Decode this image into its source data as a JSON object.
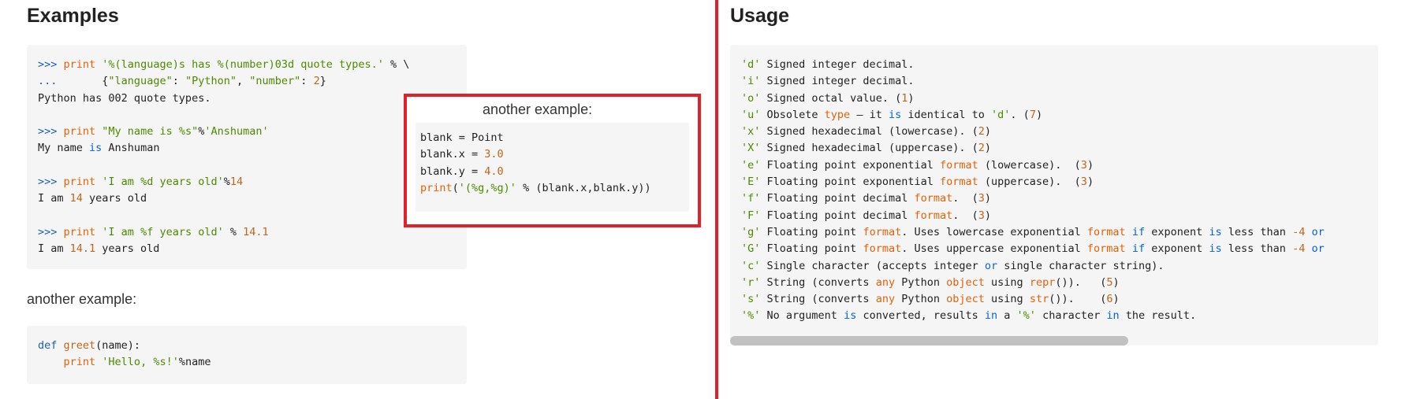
{
  "left": {
    "heading": "Examples",
    "code_block_1": [
      [
        {
          "t": ">>> ",
          "c": "pr"
        },
        {
          "t": "print ",
          "c": "kw"
        },
        {
          "t": "'%(language)s has %(number)03d quote types.'",
          "c": "str"
        },
        {
          "t": " % \\",
          "c": "plain"
        }
      ],
      [
        {
          "t": "...       ",
          "c": "pr"
        },
        {
          "t": "{",
          "c": "plain"
        },
        {
          "t": "\"language\"",
          "c": "str"
        },
        {
          "t": ": ",
          "c": "plain"
        },
        {
          "t": "\"Python\"",
          "c": "str"
        },
        {
          "t": ", ",
          "c": "plain"
        },
        {
          "t": "\"number\"",
          "c": "str"
        },
        {
          "t": ": ",
          "c": "plain"
        },
        {
          "t": "2",
          "c": "num"
        },
        {
          "t": "}",
          "c": "plain"
        }
      ],
      [
        {
          "t": "Python has 002 quote types.",
          "c": "plain"
        }
      ],
      [],
      [
        {
          "t": ">>> ",
          "c": "pr"
        },
        {
          "t": "print ",
          "c": "kw"
        },
        {
          "t": "\"My name is %s\"",
          "c": "str"
        },
        {
          "t": "%",
          "c": "plain"
        },
        {
          "t": "'Anshuman'",
          "c": "str"
        }
      ],
      [
        {
          "t": "My name ",
          "c": "plain"
        },
        {
          "t": "is",
          "c": "op"
        },
        {
          "t": " Anshuman",
          "c": "plain"
        }
      ],
      [],
      [
        {
          "t": ">>> ",
          "c": "pr"
        },
        {
          "t": "print ",
          "c": "kw"
        },
        {
          "t": "'I am %d years old'",
          "c": "str"
        },
        {
          "t": "%",
          "c": "plain"
        },
        {
          "t": "14",
          "c": "num"
        }
      ],
      [
        {
          "t": "I am ",
          "c": "plain"
        },
        {
          "t": "14",
          "c": "num"
        },
        {
          "t": " years old",
          "c": "plain"
        }
      ],
      [],
      [
        {
          "t": ">>> ",
          "c": "pr"
        },
        {
          "t": "print ",
          "c": "kw"
        },
        {
          "t": "'I am %f years old'",
          "c": "str"
        },
        {
          "t": " % ",
          "c": "plain"
        },
        {
          "t": "14.1",
          "c": "num"
        }
      ],
      [
        {
          "t": "I am ",
          "c": "plain"
        },
        {
          "t": "14.1",
          "c": "num"
        },
        {
          "t": " years old",
          "c": "plain"
        }
      ]
    ],
    "another_example_label": "another example:",
    "code_block_2": [
      [
        {
          "t": "def ",
          "c": "pr"
        },
        {
          "t": "greet",
          "c": "fn"
        },
        {
          "t": "(name):",
          "c": "plain"
        }
      ],
      [
        {
          "t": "    ",
          "c": "plain"
        },
        {
          "t": "print ",
          "c": "kw"
        },
        {
          "t": "'Hello, %s!'",
          "c": "str"
        },
        {
          "t": "%name",
          "c": "plain"
        }
      ]
    ]
  },
  "popup": {
    "label": "another example:",
    "code": [
      [
        {
          "t": "blank = Point",
          "c": "plain"
        }
      ],
      [
        {
          "t": "blank.x = ",
          "c": "plain"
        },
        {
          "t": "3.0",
          "c": "num"
        }
      ],
      [
        {
          "t": "blank.y = ",
          "c": "plain"
        },
        {
          "t": "4.0",
          "c": "num"
        }
      ],
      [
        {
          "t": "print",
          "c": "kw"
        },
        {
          "t": "(",
          "c": "plain"
        },
        {
          "t": "'(%g,%g)'",
          "c": "str"
        },
        {
          "t": " % (blank.x,blank.y))",
          "c": "plain"
        }
      ]
    ]
  },
  "right": {
    "heading": "Usage",
    "code": [
      [
        {
          "t": "'d'",
          "c": "str"
        },
        {
          "t": " Signed integer decimal.",
          "c": "plain"
        }
      ],
      [
        {
          "t": "'i'",
          "c": "str"
        },
        {
          "t": " Signed integer decimal.",
          "c": "plain"
        }
      ],
      [
        {
          "t": "'o'",
          "c": "str"
        },
        {
          "t": " Signed octal value. (",
          "c": "plain"
        },
        {
          "t": "1",
          "c": "num"
        },
        {
          "t": ")",
          "c": "plain"
        }
      ],
      [
        {
          "t": "'u'",
          "c": "str"
        },
        {
          "t": " Obsolete ",
          "c": "plain"
        },
        {
          "t": "type",
          "c": "kw"
        },
        {
          "t": " – it ",
          "c": "plain"
        },
        {
          "t": "is",
          "c": "op"
        },
        {
          "t": " identical to ",
          "c": "plain"
        },
        {
          "t": "'d'",
          "c": "str"
        },
        {
          "t": ". (",
          "c": "plain"
        },
        {
          "t": "7",
          "c": "num"
        },
        {
          "t": ")",
          "c": "plain"
        }
      ],
      [
        {
          "t": "'x'",
          "c": "str"
        },
        {
          "t": " Signed hexadecimal (lowercase). (",
          "c": "plain"
        },
        {
          "t": "2",
          "c": "num"
        },
        {
          "t": ")",
          "c": "plain"
        }
      ],
      [
        {
          "t": "'X'",
          "c": "str"
        },
        {
          "t": " Signed hexadecimal (uppercase). (",
          "c": "plain"
        },
        {
          "t": "2",
          "c": "num"
        },
        {
          "t": ")",
          "c": "plain"
        }
      ],
      [
        {
          "t": "'e'",
          "c": "str"
        },
        {
          "t": " Floating point exponential ",
          "c": "plain"
        },
        {
          "t": "format",
          "c": "kw"
        },
        {
          "t": " (lowercase).  (",
          "c": "plain"
        },
        {
          "t": "3",
          "c": "num"
        },
        {
          "t": ")",
          "c": "plain"
        }
      ],
      [
        {
          "t": "'E'",
          "c": "str"
        },
        {
          "t": " Floating point exponential ",
          "c": "plain"
        },
        {
          "t": "format",
          "c": "kw"
        },
        {
          "t": " (uppercase).  (",
          "c": "plain"
        },
        {
          "t": "3",
          "c": "num"
        },
        {
          "t": ")",
          "c": "plain"
        }
      ],
      [
        {
          "t": "'f'",
          "c": "str"
        },
        {
          "t": " Floating point decimal ",
          "c": "plain"
        },
        {
          "t": "format",
          "c": "kw"
        },
        {
          "t": ".  (",
          "c": "plain"
        },
        {
          "t": "3",
          "c": "num"
        },
        {
          "t": ")",
          "c": "plain"
        }
      ],
      [
        {
          "t": "'F'",
          "c": "str"
        },
        {
          "t": " Floating point decimal ",
          "c": "plain"
        },
        {
          "t": "format",
          "c": "kw"
        },
        {
          "t": ".  (",
          "c": "plain"
        },
        {
          "t": "3",
          "c": "num"
        },
        {
          "t": ")",
          "c": "plain"
        }
      ],
      [
        {
          "t": "'g'",
          "c": "str"
        },
        {
          "t": " Floating point ",
          "c": "plain"
        },
        {
          "t": "format",
          "c": "kw"
        },
        {
          "t": ". Uses lowercase exponential ",
          "c": "plain"
        },
        {
          "t": "format",
          "c": "kw"
        },
        {
          "t": " ",
          "c": "plain"
        },
        {
          "t": "if",
          "c": "op"
        },
        {
          "t": " exponent ",
          "c": "plain"
        },
        {
          "t": "is",
          "c": "op"
        },
        {
          "t": " less than ",
          "c": "plain"
        },
        {
          "t": "-4",
          "c": "num"
        },
        {
          "t": " ",
          "c": "plain"
        },
        {
          "t": "or",
          "c": "op"
        }
      ],
      [
        {
          "t": "'G'",
          "c": "str"
        },
        {
          "t": " Floating point ",
          "c": "plain"
        },
        {
          "t": "format",
          "c": "kw"
        },
        {
          "t": ". Uses uppercase exponential ",
          "c": "plain"
        },
        {
          "t": "format",
          "c": "kw"
        },
        {
          "t": " ",
          "c": "plain"
        },
        {
          "t": "if",
          "c": "op"
        },
        {
          "t": " exponent ",
          "c": "plain"
        },
        {
          "t": "is",
          "c": "op"
        },
        {
          "t": " less than ",
          "c": "plain"
        },
        {
          "t": "-4",
          "c": "num"
        },
        {
          "t": " ",
          "c": "plain"
        },
        {
          "t": "or",
          "c": "op"
        }
      ],
      [
        {
          "t": "'c'",
          "c": "str"
        },
        {
          "t": " Single character (accepts integer ",
          "c": "plain"
        },
        {
          "t": "or",
          "c": "op"
        },
        {
          "t": " single character string).",
          "c": "plain"
        }
      ],
      [
        {
          "t": "'r'",
          "c": "str"
        },
        {
          "t": " String (converts ",
          "c": "plain"
        },
        {
          "t": "any",
          "c": "kw"
        },
        {
          "t": " Python ",
          "c": "plain"
        },
        {
          "t": "object",
          "c": "kw"
        },
        {
          "t": " using ",
          "c": "plain"
        },
        {
          "t": "repr",
          "c": "kw"
        },
        {
          "t": "()).   (",
          "c": "plain"
        },
        {
          "t": "5",
          "c": "num"
        },
        {
          "t": ")",
          "c": "plain"
        }
      ],
      [
        {
          "t": "'s'",
          "c": "str"
        },
        {
          "t": " String (converts ",
          "c": "plain"
        },
        {
          "t": "any",
          "c": "kw"
        },
        {
          "t": " Python ",
          "c": "plain"
        },
        {
          "t": "object",
          "c": "kw"
        },
        {
          "t": " using ",
          "c": "plain"
        },
        {
          "t": "str",
          "c": "kw"
        },
        {
          "t": "()).    (",
          "c": "plain"
        },
        {
          "t": "6",
          "c": "num"
        },
        {
          "t": ")",
          "c": "plain"
        }
      ],
      [
        {
          "t": "'%'",
          "c": "str"
        },
        {
          "t": " No argument ",
          "c": "plain"
        },
        {
          "t": "is",
          "c": "op"
        },
        {
          "t": " converted, results ",
          "c": "plain"
        },
        {
          "t": "in",
          "c": "op"
        },
        {
          "t": " a ",
          "c": "plain"
        },
        {
          "t": "'%'",
          "c": "str"
        },
        {
          "t": " character ",
          "c": "plain"
        },
        {
          "t": "in",
          "c": "op"
        },
        {
          "t": " the result.",
          "c": "plain"
        }
      ]
    ]
  },
  "colors": {
    "divider": "#e0202a",
    "popup_border": "#e0202a",
    "code_background": "#f5f5f5"
  }
}
